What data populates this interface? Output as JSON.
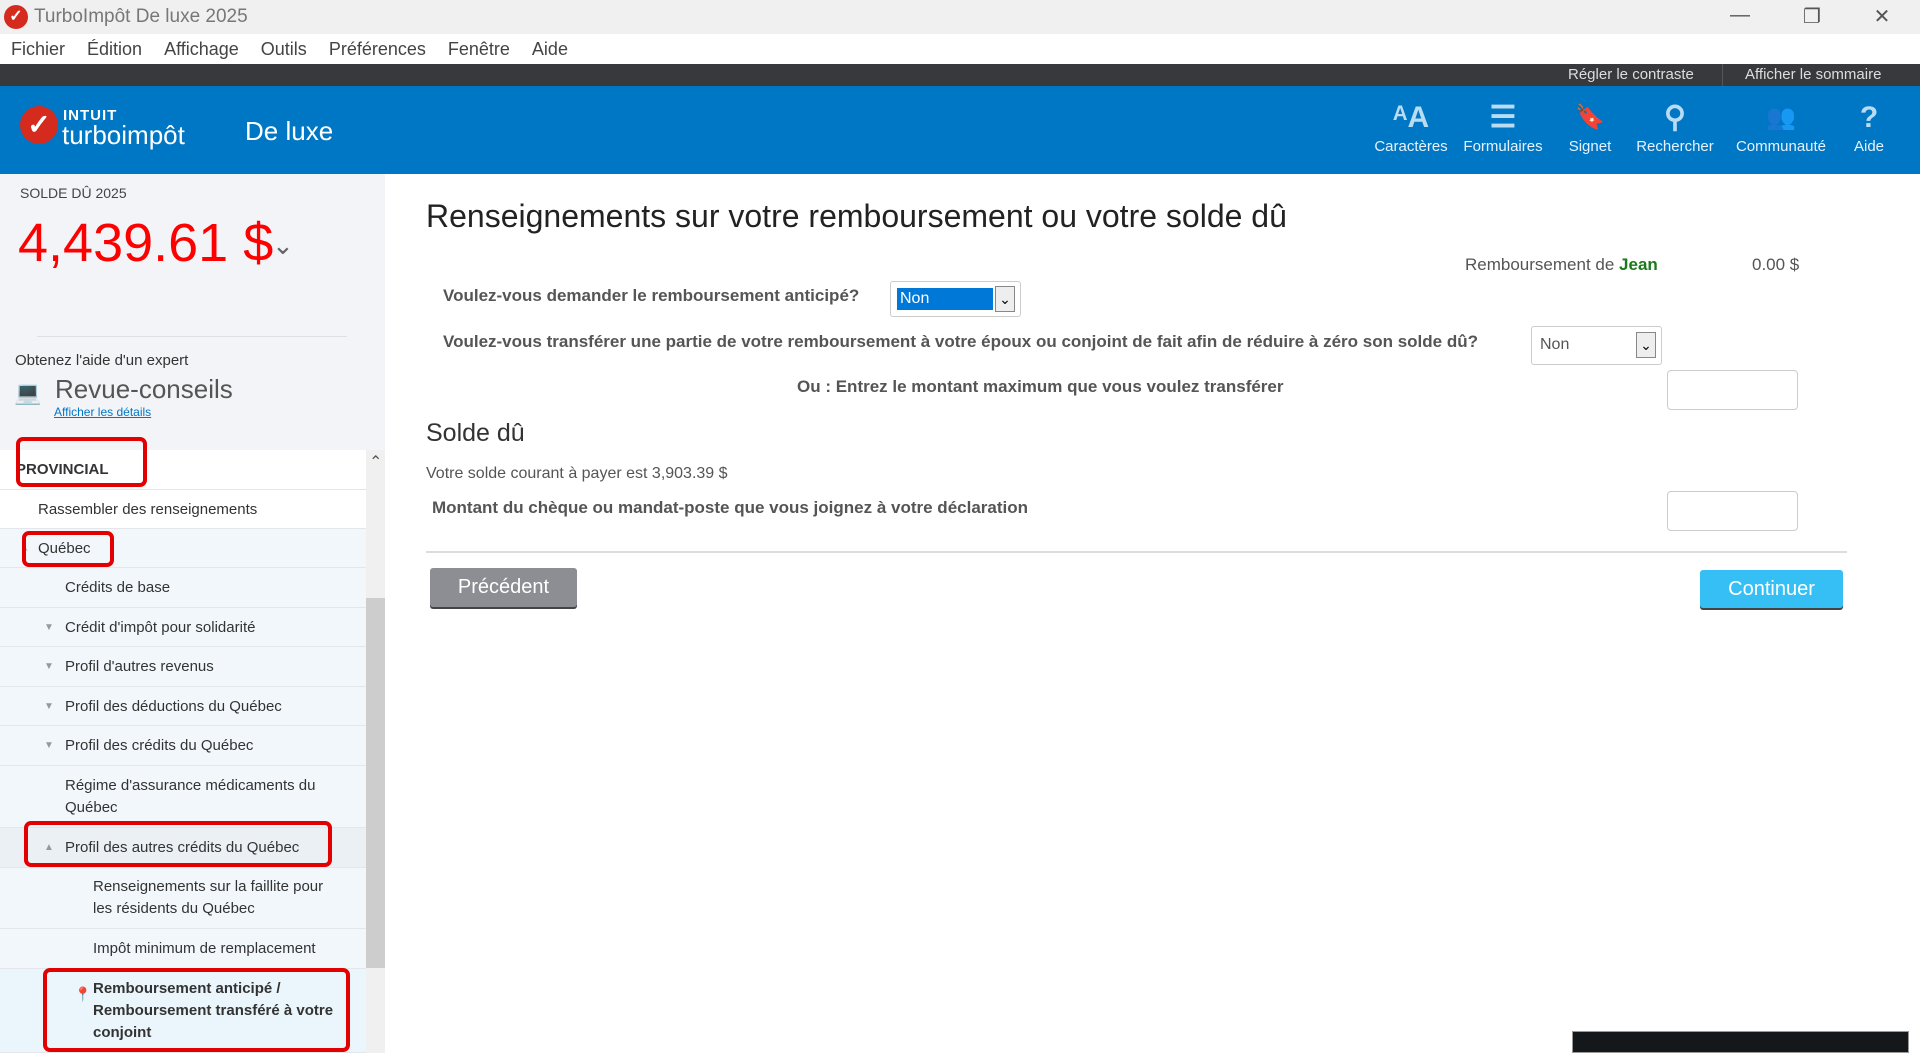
{
  "window": {
    "title": "TurboImpôt De luxe 2025",
    "minimize": "—",
    "restore": "❐",
    "close": "✕"
  },
  "menu": [
    "Fichier",
    "Édition",
    "Affichage",
    "Outils",
    "Préférences",
    "Fenêtre",
    "Aide"
  ],
  "topbar": {
    "contrast": "Régler le contraste",
    "summary": "Afficher le sommaire"
  },
  "header": {
    "brand_top": "INTUIT",
    "brand": "turboimpôt",
    "edition": "De luxe",
    "tools": [
      {
        "label": "Caractères",
        "icon": "font-size-icon",
        "glyph": "ᴬA"
      },
      {
        "label": "Formulaires",
        "icon": "document-icon",
        "glyph": "☰"
      },
      {
        "label": "Signet",
        "icon": "bookmark-icon",
        "glyph": "🔖"
      },
      {
        "label": "Rechercher",
        "icon": "search-icon",
        "glyph": "⚲"
      },
      {
        "label": "Communauté",
        "icon": "community-icon",
        "glyph": "👥"
      },
      {
        "label": "Aide",
        "icon": "help-icon",
        "glyph": "?"
      }
    ]
  },
  "sidebar": {
    "balance_label": "SOLDE DÛ 2025",
    "balance": "4,439.61 $",
    "expert_label": "Obtenez l'aide d'un expert",
    "review": "Revue-conseils",
    "details_link": "Afficher les détails",
    "nav": {
      "section": "PROVINCIAL",
      "items": [
        "Rassembler des renseignements",
        "Québec",
        "Crédits de base",
        "Crédit d'impôt pour solidarité",
        "Profil d'autres revenus",
        "Profil des déductions du Québec",
        "Profil des crédits du Québec",
        "Régime d'assurance médicaments du Québec",
        "Profil des autres crédits du Québec",
        "Renseignements sur la faillite pour les résidents du Québec",
        "Impôt minimum de remplacement",
        "Remboursement anticipé / Remboursement transféré à votre conjoint"
      ]
    }
  },
  "main": {
    "title": "Renseignements sur votre remboursement ou votre solde dû",
    "refund_label": "Remboursement de",
    "refund_name": "Jean",
    "refund_amount": "0.00 $",
    "q1": "Voulez-vous demander le remboursement anticipé?",
    "q1_value": "Non",
    "q2": "Voulez-vous transférer une partie de votre remboursement à votre époux ou conjoint de fait afin de réduire à zéro son solde dû?",
    "q2_value": "Non",
    "q3": "Ou : Entrez le montant maximum que vous voulez transférer",
    "q3_value": "",
    "balance_heading": "Solde dû",
    "balance_text": "Votre solde courant à payer est 3,903.39 $",
    "cheque_label": "Montant du chèque ou mandat-poste que vous joignez à votre déclaration",
    "cheque_value": "",
    "prev": "Précédent",
    "next": "Continuer"
  },
  "colors": {
    "brand_blue": "#0077c5",
    "balance_red": "#ff0000",
    "continue": "#36bff5",
    "name_green": "#1a7a1a"
  }
}
